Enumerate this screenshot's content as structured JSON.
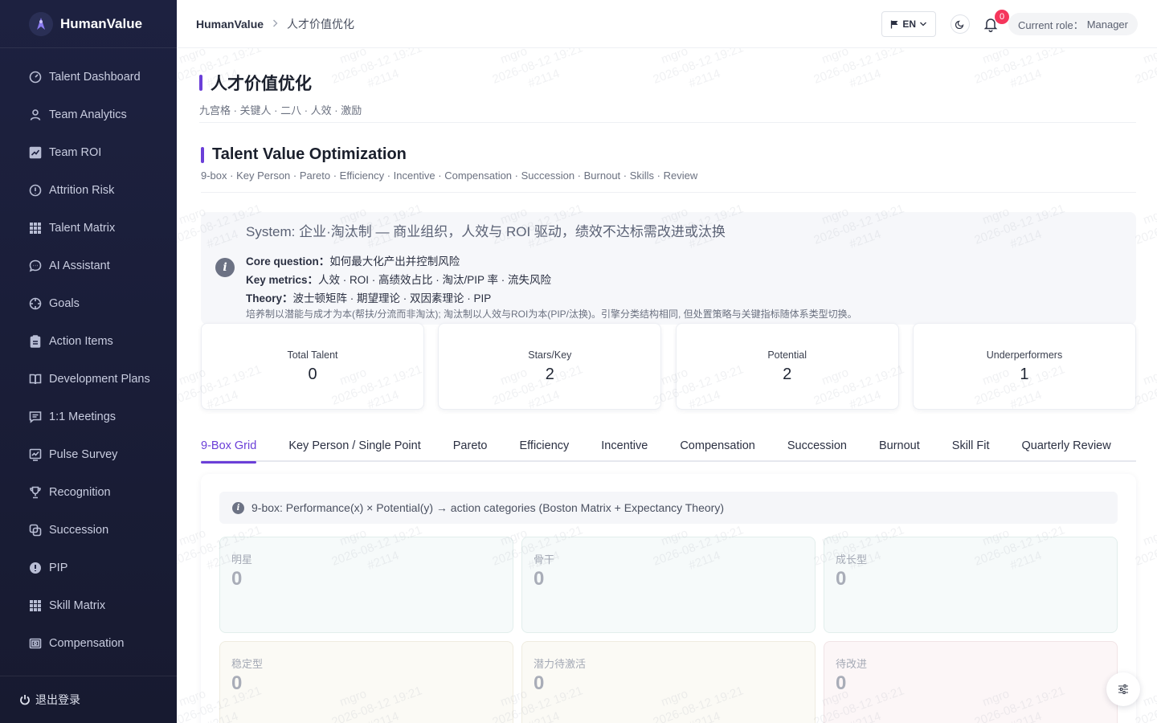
{
  "app": {
    "name": "HumanValue"
  },
  "sidebar": {
    "items": [
      {
        "label": "Talent Dashboard",
        "icon": "dashboard-icon"
      },
      {
        "label": "Team Analytics",
        "icon": "user-icon"
      },
      {
        "label": "Team ROI",
        "icon": "chart-icon"
      },
      {
        "label": "Attrition Risk",
        "icon": "alert-circle-icon"
      },
      {
        "label": "Talent Matrix",
        "icon": "grid-icon"
      },
      {
        "label": "AI Assistant",
        "icon": "chat-icon"
      },
      {
        "label": "Goals",
        "icon": "target-icon"
      },
      {
        "label": "Action Items",
        "icon": "clipboard-icon"
      },
      {
        "label": "Development Plans",
        "icon": "book-icon"
      },
      {
        "label": "1:1 Meetings",
        "icon": "message-icon"
      },
      {
        "label": "Pulse Survey",
        "icon": "survey-icon"
      },
      {
        "label": "Recognition",
        "icon": "trophy-icon"
      },
      {
        "label": "Succession",
        "icon": "succession-icon"
      },
      {
        "label": "PIP",
        "icon": "warning-icon"
      },
      {
        "label": "Skill Matrix",
        "icon": "grid-icon"
      },
      {
        "label": "Compensation",
        "icon": "money-icon"
      }
    ],
    "logout_label": "退出登录"
  },
  "header": {
    "breadcrumb_root": "HumanValue",
    "breadcrumb_current": "人才价值优化",
    "lang": "EN",
    "notification_count": "0",
    "role_label": "Current role：",
    "role_value": "Manager"
  },
  "page": {
    "title": "人才价值优化",
    "subtitle": "九宫格 · 关键人 · 二八 · 人效 · 激励"
  },
  "section": {
    "title": "Talent Value Optimization",
    "subtitle": "9-box · Key Person · Pareto · Efficiency · Incentive · Compensation · Succession · Burnout · Skills · Review"
  },
  "info": {
    "system": "System: 企业·淘汰制 — 商业组织，人效与 ROI 驱动，绩效不达标需改进或汰换",
    "core_label": "Core question：",
    "core_value": "如何最大化产出并控制风险",
    "metrics_label": "Key metrics：",
    "metrics_value": "人效 · ROI · 高绩效占比 · 淘汰/PIP 率 · 流失风险",
    "theory_label": "Theory：",
    "theory_value": "波士顿矩阵 · 期望理论 · 双因素理论 · PIP",
    "note": "培养制以潜能与成才为本(帮扶/分流而非淘汰); 淘汰制以人效与ROI为本(PIP/汰换)。引擎分类结构相同, 但处置策略与关键指标随体系类型切换。"
  },
  "stats": [
    {
      "label": "Total Talent",
      "value": "0"
    },
    {
      "label": "Stars/Key",
      "value": "2"
    },
    {
      "label": "Potential",
      "value": "2"
    },
    {
      "label": "Underperformers",
      "value": "1"
    }
  ],
  "tabs": [
    {
      "label": "9-Box Grid",
      "active": true
    },
    {
      "label": "Key Person / Single Point"
    },
    {
      "label": "Pareto"
    },
    {
      "label": "Efficiency"
    },
    {
      "label": "Incentive"
    },
    {
      "label": "Compensation"
    },
    {
      "label": "Succession"
    },
    {
      "label": "Burnout"
    },
    {
      "label": "Skill Fit"
    },
    {
      "label": "Quarterly Review"
    }
  ],
  "ninebox": {
    "hint": "9-box: Performance(x) × Potential(y) → action categories (Boston Matrix + Expectancy Theory)",
    "cells": [
      {
        "label": "明星",
        "value": "0"
      },
      {
        "label": "骨干",
        "value": "0"
      },
      {
        "label": "成长型",
        "value": "0"
      },
      {
        "label": "稳定型",
        "value": "0"
      },
      {
        "label": "潜力待激活",
        "value": "0"
      },
      {
        "label": "待改进",
        "value": "0"
      }
    ]
  },
  "watermark": {
    "user": "mgro",
    "time": "2026-08-12 19:21",
    "id": "#2114"
  },
  "colors": {
    "accent": "#6b3fd8",
    "sidebar_bg": "#1d2140",
    "badge": "#f5365c"
  }
}
